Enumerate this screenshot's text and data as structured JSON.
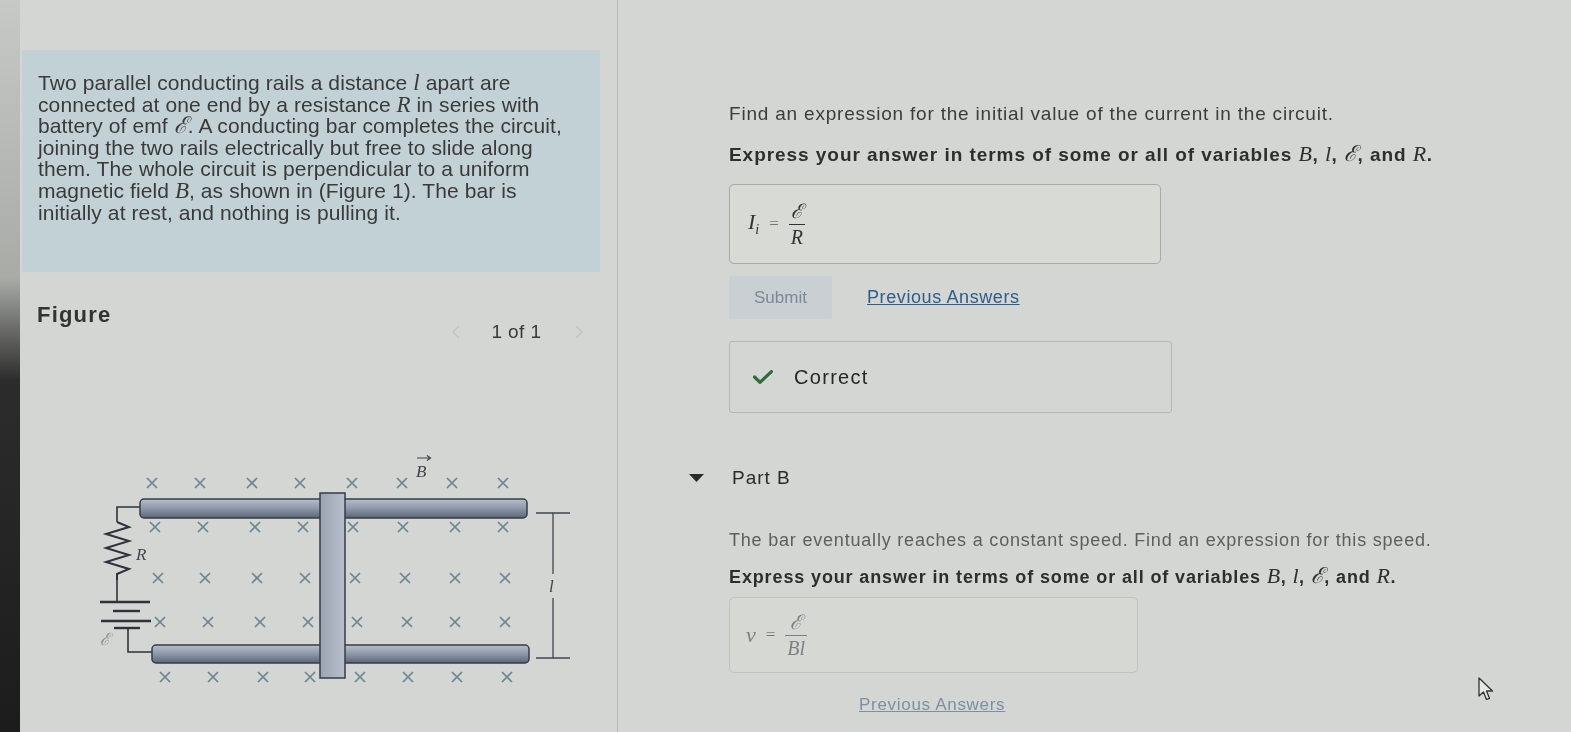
{
  "problem": {
    "text": "Two parallel conducting rails a distance *l* apart are connected at one end by a resistance *R* in series with battery of emf *ℰ*. A conducting bar completes the circuit, joining the two rails electrically but free to slide along them. The whole circuit is perpendicular to a uniform magnetic field *B*, as shown in (Figure 1). The bar is initially at rest, and nothing is pulling it."
  },
  "figure": {
    "title": "Figure",
    "pager": {
      "text": "1 of 1",
      "prev_disabled": true,
      "next_disabled": true
    },
    "labels": {
      "field": "B",
      "resistance": "R",
      "emf": "ℰ",
      "separation": "l"
    }
  },
  "part_a": {
    "prompt": "Find an expression for the initial value of the current in the circuit.",
    "instruction": "Express your answer in terms of some or all of variables *B*, *l*, *ℰ*, and *R*.",
    "answer": {
      "symbol": "I",
      "subscript": "i",
      "relation": "=",
      "numerator": "ℰ",
      "denominator": "R"
    },
    "submit": {
      "label": "Submit",
      "disabled": true
    },
    "previous_answers": "Previous Answers",
    "feedback": {
      "kind": "correct",
      "text": "Correct"
    }
  },
  "part_b": {
    "title": "Part B",
    "expanded": true,
    "prompt": "The bar eventually reaches a constant speed. Find an expression for this speed.",
    "instruction": "Express your answer in terms of some or all of variables *B*, *l*, *ℰ*, and *R*.",
    "answer": {
      "symbol": "v",
      "relation": "=",
      "numerator": "ℰ",
      "denominator": "Bl"
    },
    "previous_answers": "Previous Answers"
  }
}
